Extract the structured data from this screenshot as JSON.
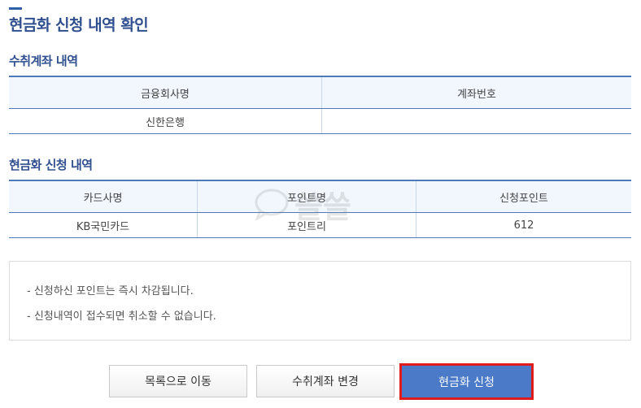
{
  "page": {
    "title": "현금화 신청 내역 확인"
  },
  "account_section": {
    "title": "수취계좌 내역",
    "headers": [
      "금융회사명",
      "계좌번호"
    ],
    "row": [
      "신한은행",
      ""
    ]
  },
  "cash_section": {
    "title": "현금화 신청 내역",
    "headers": [
      "카드사명",
      "포인트명",
      "신청포인트"
    ],
    "row": [
      "KB국민카드",
      "포인트리",
      "612"
    ]
  },
  "notice": {
    "lines": [
      "- 신청하신 포인트는 즉시 차감됩니다.",
      "- 신청내역이 접수되면 취소할 수 없습니다."
    ]
  },
  "buttons": {
    "list": "목록으로 이동",
    "change_account": "수취계좌 변경",
    "apply": "현금화 신청"
  },
  "watermark": {
    "text": "쓸쓸",
    "icon": "chat-bubble-icon"
  },
  "colors": {
    "accent": "#2f4f8f",
    "primary_button": "#4a7ac8",
    "highlight_border": "#e01b1b"
  }
}
